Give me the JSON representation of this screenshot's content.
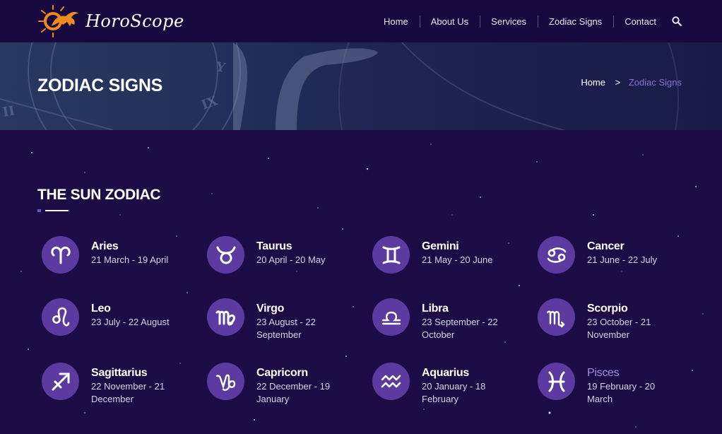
{
  "header": {
    "logo_text": "HoroScope",
    "nav": [
      "Home",
      "About Us",
      "Services",
      "Zodiac Signs",
      "Contact"
    ]
  },
  "banner": {
    "title": "ZODIAC SIGNS",
    "breadcrumb": {
      "home": "Home",
      "separator": ">",
      "current": "Zodiac Signs"
    }
  },
  "section": {
    "title": "THE SUN ZODIAC"
  },
  "signs": [
    {
      "name": "Aries",
      "dates": "21 March - 19 April",
      "icon": "aries-icon"
    },
    {
      "name": "Taurus",
      "dates": "20 April - 20 May",
      "icon": "taurus-icon"
    },
    {
      "name": "Gemini",
      "dates": "21 May - 20 June",
      "icon": "gemini-icon"
    },
    {
      "name": "Cancer",
      "dates": "21 June - 22 July",
      "icon": "cancer-icon"
    },
    {
      "name": "Leo",
      "dates": "23 July - 22 August",
      "icon": "leo-icon"
    },
    {
      "name": "Virgo",
      "dates": "23 August - 22 September",
      "icon": "virgo-icon"
    },
    {
      "name": "Libra",
      "dates": "23 September - 22 October",
      "icon": "libra-icon"
    },
    {
      "name": "Scorpio",
      "dates": "23 October - 21 November",
      "icon": "scorpio-icon"
    },
    {
      "name": "Sagittarius",
      "dates": "22 November - 21 December",
      "icon": "sagittarius-icon"
    },
    {
      "name": "Capricorn",
      "dates": "22 December - 19 January",
      "icon": "capricorn-icon"
    },
    {
      "name": "Aquarius",
      "dates": "20 January - 18 February",
      "icon": "aquarius-icon"
    },
    {
      "name": "Pisces",
      "dates": "19 February - 20 March",
      "icon": "pisces-icon",
      "active": true
    }
  ],
  "colors": {
    "page_background": "#1c0b45",
    "header_background": "#180840",
    "icon_circle": "#5c3aa0",
    "accent": "#8a72d6"
  }
}
